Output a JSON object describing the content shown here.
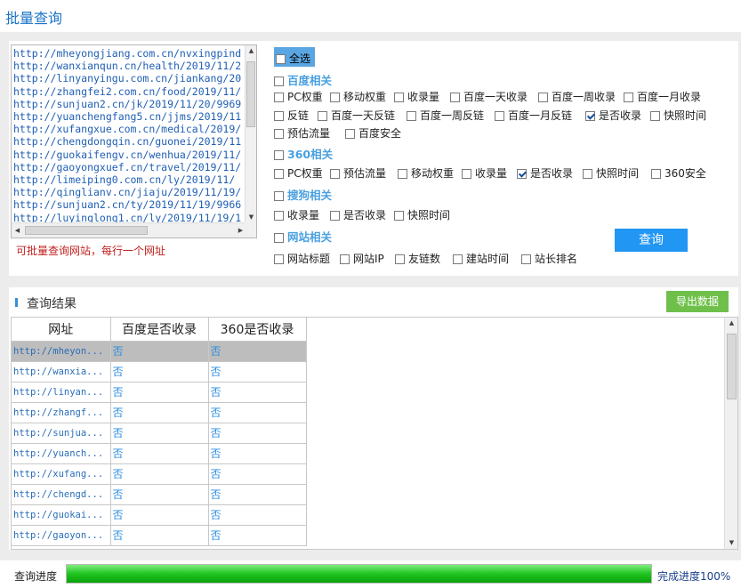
{
  "window": {
    "title": "批量查询"
  },
  "urls": [
    "http://mheyongjiang.com.cn/nvxingpind",
    "http://wanxianqun.cn/health/2019/11/2",
    "http://linyanyingu.com.cn/jiankang/20",
    "http://zhangfei2.com.cn/food/2019/11/",
    "http://sunjuan2.cn/jk/2019/11/20/9969",
    "http://yuanchengfang5.cn/jjms/2019/11",
    "http://xufangxue.com.cn/medical/2019/",
    "http://chengdongqin.cn/guonei/2019/11",
    "http://guokaifengv.cn/wenhua/2019/11/",
    "http://gaoyongxuef.cn/travel/2019/11/",
    "http://limeiping0.com.cn/ly/2019/11/",
    "http://qinglianv.cn/jiaju/2019/11/19/",
    "http://sunjuan2.cn/ty/2019/11/19/9966",
    "http://luyinglong1.cn/ly/2019/11/19/1"
  ],
  "hint": "可批量查询网站，每行一个网址",
  "options": {
    "select_all": "全选",
    "baidu": {
      "label": "百度相关",
      "items": [
        "PC权重",
        "移动权重",
        "收录量",
        "百度一天收录",
        "百度一周收录",
        "百度一月收录",
        "反链",
        "百度一天反链",
        "百度一周反链",
        "百度一月反链",
        "是否收录",
        "快照时间",
        "预估流量",
        "百度安全"
      ]
    },
    "s360": {
      "label": "360相关",
      "items": [
        "PC权重",
        "预估流量",
        "移动权重",
        "收录量",
        "是否收录",
        "快照时间",
        "360安全"
      ]
    },
    "sogou": {
      "label": "搜狗相关",
      "items": [
        "收录量",
        "是否收录",
        "快照时间"
      ]
    },
    "site": {
      "label": "网站相关",
      "items": [
        "网站标题",
        "网站IP",
        "友链数",
        "建站时间",
        "站长排名"
      ]
    },
    "checked": [
      "baidu:是否收录",
      "360:是否收录"
    ]
  },
  "query_button": "查询",
  "results": {
    "title": "查询结果",
    "export_button": "导出数据",
    "columns": [
      "网址",
      "百度是否收录",
      "360是否收录"
    ],
    "rows": [
      [
        "http://mheyon...",
        "否",
        "否"
      ],
      [
        "http://wanxia...",
        "否",
        "否"
      ],
      [
        "http://linyan...",
        "否",
        "否"
      ],
      [
        "http://zhangf...",
        "否",
        "否"
      ],
      [
        "http://sunjua...",
        "否",
        "否"
      ],
      [
        "http://yuanch...",
        "否",
        "否"
      ],
      [
        "http://xufang...",
        "否",
        "否"
      ],
      [
        "http://chengd...",
        "否",
        "否"
      ],
      [
        "http://guokai...",
        "否",
        "否"
      ],
      [
        "http://gaoyon...",
        "否",
        "否"
      ]
    ],
    "selected_row": 0
  },
  "progress": {
    "label": "查询进度",
    "value": 1.0,
    "status": "完成进度100%"
  }
}
